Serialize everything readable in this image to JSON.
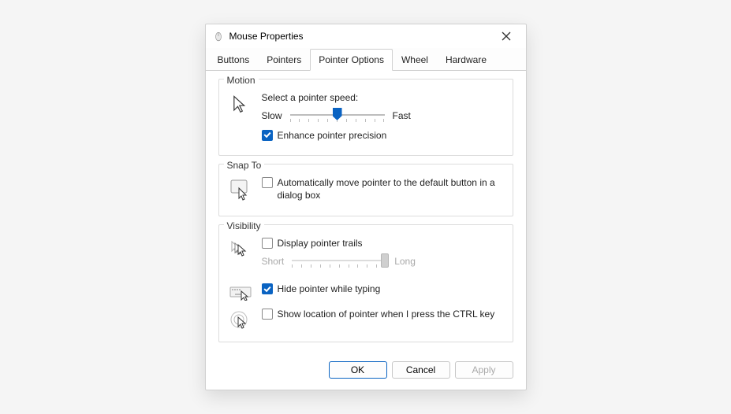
{
  "title": "Mouse Properties",
  "tabs": {
    "buttons": "Buttons",
    "pointers": "Pointers",
    "pointer_options": "Pointer Options",
    "wheel": "Wheel",
    "hardware": "Hardware"
  },
  "motion": {
    "group_title": "Motion",
    "speed_label": "Select a pointer speed:",
    "slow": "Slow",
    "fast": "Fast",
    "speed_value": 6,
    "speed_min": 1,
    "speed_max": 11,
    "enhance_checked": true,
    "enhance_label": "Enhance pointer precision"
  },
  "snap": {
    "group_title": "Snap To",
    "auto_checked": false,
    "auto_label": "Automatically move pointer to the default button in a dialog box"
  },
  "visibility": {
    "group_title": "Visibility",
    "trails_checked": false,
    "trails_label": "Display pointer trails",
    "short": "Short",
    "long": "Long",
    "trails_enabled": false,
    "hide_checked": true,
    "hide_label": "Hide pointer while typing",
    "ctrl_checked": false,
    "ctrl_label": "Show location of pointer when I press the CTRL key"
  },
  "buttons": {
    "ok": "OK",
    "cancel": "Cancel",
    "apply": "Apply"
  }
}
